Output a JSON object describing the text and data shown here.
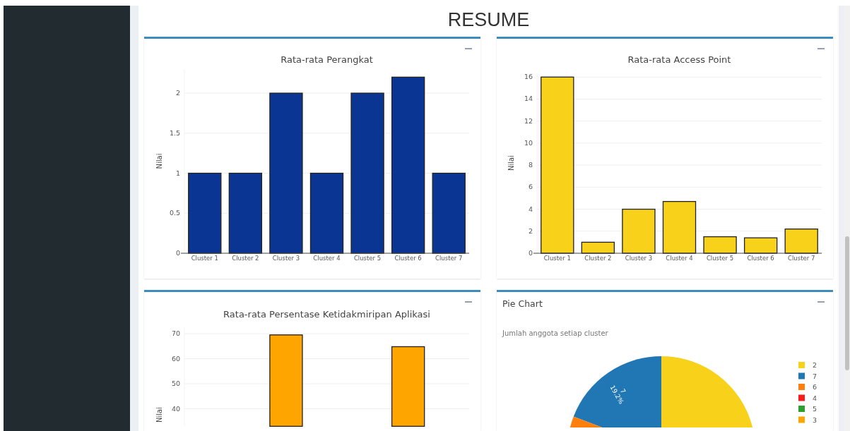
{
  "page_title": "RESUME",
  "cards": [
    {
      "kind": "bar",
      "chart_data": {
        "type": "bar",
        "title": "Rata-rata Perangkat",
        "ylabel": "Nilai",
        "categories": [
          "Cluster 1",
          "Cluster 2",
          "Cluster 3",
          "Cluster 4",
          "Cluster 5",
          "Cluster 6",
          "Cluster 7"
        ],
        "grid": true,
        "series": [
          {
            "color": "#0b3592",
            "values": [
              1,
              1,
              2,
              1,
              2,
              2.2,
              1
            ]
          }
        ],
        "ylim": [
          0,
          2.3
        ],
        "yticks": [
          0,
          0.5,
          1,
          1.5,
          2
        ]
      }
    },
    {
      "kind": "bar",
      "chart_data": {
        "type": "bar",
        "title": "Rata-rata Access Point",
        "ylabel": "Nilai",
        "categories": [
          "Cluster 1",
          "Cluster 2",
          "Cluster 3",
          "Cluster 4",
          "Cluster 5",
          "Cluster 6",
          "Cluster 7"
        ],
        "grid": true,
        "series": [
          {
            "color": "#f7d11a",
            "values": [
              16,
              1,
              4,
              4.7,
              1.5,
              1.4,
              2.2
            ]
          }
        ],
        "ylim": [
          0,
          16.4
        ],
        "yticks": [
          0,
          2,
          4,
          6,
          8,
          10,
          12,
          14,
          16
        ]
      }
    },
    {
      "kind": "bar",
      "chart_data": {
        "type": "bar",
        "title": "Rata-rata Persentase Ketidakmiripan Aplikasi",
        "ylabel": "Nilai",
        "grid": true,
        "series": [
          {
            "color": "#ffa500",
            "values": [
              null,
              null,
              69.5,
              null,
              null,
              64.8,
              null
            ]
          }
        ],
        "ylim": [
          33,
          72.5
        ],
        "yticks": [
          40,
          50,
          60,
          70
        ]
      }
    },
    {
      "kind": "pie",
      "title": "Pie Chart",
      "subtitle": "Jumlah anggota setiap cluster",
      "slice_label": "7",
      "slice_percent": "19.2%",
      "legend": [
        {
          "label": "2",
          "color": "#f7d11a"
        },
        {
          "label": "7",
          "color": "#2077b4"
        },
        {
          "label": "6",
          "color": "#ff7f0e"
        },
        {
          "label": "4",
          "color": "#f71c1c"
        },
        {
          "label": "5",
          "color": "#2ca02c"
        },
        {
          "label": "3",
          "color": "#ffa500"
        }
      ]
    }
  ]
}
